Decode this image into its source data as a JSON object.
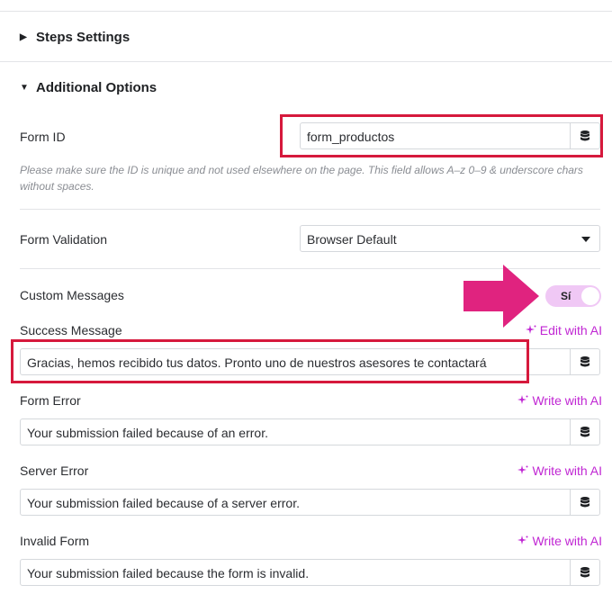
{
  "sections": {
    "steps_settings": "Steps Settings",
    "additional_options": "Additional Options"
  },
  "form_id": {
    "label": "Form ID",
    "value": "form_productos",
    "help": "Please make sure the ID is unique and not used elsewhere on the page. This field allows A–z  0–9 & underscore chars without spaces."
  },
  "form_validation": {
    "label": "Form Validation",
    "value": "Browser Default"
  },
  "custom_messages": {
    "label": "Custom Messages",
    "toggle_label": "Sí",
    "enabled": true
  },
  "success_message": {
    "label": "Success Message",
    "ai_action": "Edit with AI",
    "value": "Gracias, hemos recibido tus datos. Pronto uno de nuestros asesores te contactará"
  },
  "form_error": {
    "label": "Form Error",
    "ai_action": "Write with AI",
    "value": "Your submission failed because of an error."
  },
  "server_error": {
    "label": "Server Error",
    "ai_action": "Write with AI",
    "value": "Your submission failed because of a server error."
  },
  "invalid_form": {
    "label": "Invalid Form",
    "ai_action": "Write with AI",
    "value": "Your submission failed because the form is invalid."
  },
  "colors": {
    "accent_ai": "#c026d3",
    "toggle_bg": "#f0c8f5",
    "highlight_red": "#d6193c",
    "arrow_pink": "#e0237f"
  },
  "icons": {
    "collapsed": "triangle-right-icon",
    "expanded": "triangle-down-icon",
    "dynamic_tags": "database-icon",
    "ai": "sparkle-icon",
    "select": "chevron-down-icon"
  }
}
